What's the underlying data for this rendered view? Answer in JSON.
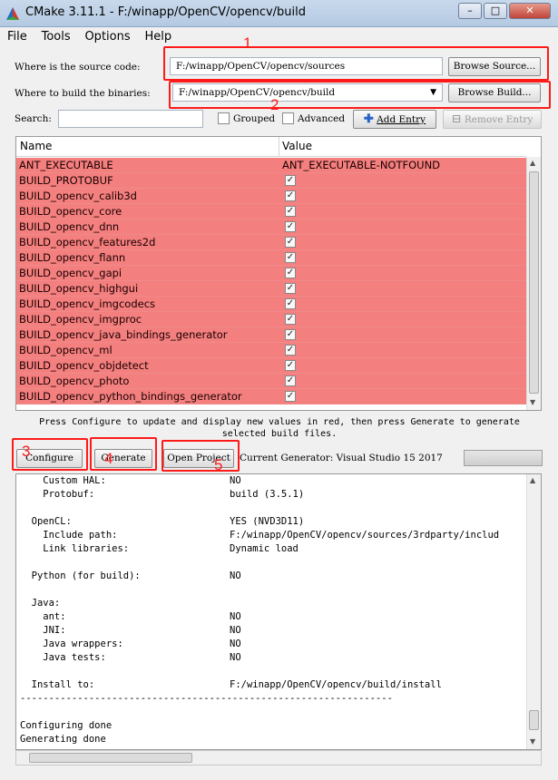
{
  "window": {
    "title": "CMake 3.11.1 - F:/winapp/OpenCV/opencv/build",
    "minimize": "–",
    "maximize": "□",
    "close": "✕"
  },
  "menu": [
    "File",
    "Tools",
    "Options",
    "Help"
  ],
  "source": {
    "label": "Where is the source code:",
    "value": "F:/winapp/OpenCV/opencv/sources",
    "browse": "Browse Source..."
  },
  "build": {
    "label": "Where to build the binaries:",
    "value": "F:/winapp/OpenCV/opencv/build",
    "browse": "Browse Build..."
  },
  "search": {
    "label": "Search:",
    "value": ""
  },
  "grouped": {
    "label": "Grouped",
    "checked": false
  },
  "advanced": {
    "label": "Advanced",
    "checked": false
  },
  "add_entry": "Add Entry",
  "remove_entry": "Remove Entry",
  "table": {
    "headers": [
      "Name",
      "Value"
    ],
    "rows": [
      {
        "name": "ANT_EXECUTABLE",
        "value": "ANT_EXECUTABLE-NOTFOUND",
        "type": "text"
      },
      {
        "name": "BUILD_PROTOBUF",
        "value": "true",
        "type": "bool"
      },
      {
        "name": "BUILD_opencv_calib3d",
        "value": "true",
        "type": "bool"
      },
      {
        "name": "BUILD_opencv_core",
        "value": "true",
        "type": "bool"
      },
      {
        "name": "BUILD_opencv_dnn",
        "value": "true",
        "type": "bool"
      },
      {
        "name": "BUILD_opencv_features2d",
        "value": "true",
        "type": "bool"
      },
      {
        "name": "BUILD_opencv_flann",
        "value": "true",
        "type": "bool"
      },
      {
        "name": "BUILD_opencv_gapi",
        "value": "true",
        "type": "bool"
      },
      {
        "name": "BUILD_opencv_highgui",
        "value": "true",
        "type": "bool"
      },
      {
        "name": "BUILD_opencv_imgcodecs",
        "value": "true",
        "type": "bool"
      },
      {
        "name": "BUILD_opencv_imgproc",
        "value": "true",
        "type": "bool"
      },
      {
        "name": "BUILD_opencv_java_bindings_generator",
        "value": "true",
        "type": "bool"
      },
      {
        "name": "BUILD_opencv_ml",
        "value": "true",
        "type": "bool"
      },
      {
        "name": "BUILD_opencv_objdetect",
        "value": "true",
        "type": "bool"
      },
      {
        "name": "BUILD_opencv_photo",
        "value": "true",
        "type": "bool"
      },
      {
        "name": "BUILD_opencv_python_bindings_generator",
        "value": "true",
        "type": "bool"
      }
    ],
    "row_color": "#f47f7f"
  },
  "info_text": "Press Configure to update and display new values in red, then press Generate to generate selected build files.",
  "buttons": {
    "configure": "Configure",
    "generate": "Generate",
    "open_project": "Open Project"
  },
  "generator": "Current Generator: Visual Studio 15 2017",
  "output_lines": [
    {
      "k": "    Custom HAL:",
      "v": "NO"
    },
    {
      "k": "    Protobuf:",
      "v": "build (3.5.1)"
    },
    {
      "k": "",
      "v": ""
    },
    {
      "k": "  OpenCL:",
      "v": "YES (NVD3D11)"
    },
    {
      "k": "    Include path:",
      "v": "F:/winapp/OpenCV/opencv/sources/3rdparty/includ"
    },
    {
      "k": "    Link libraries:",
      "v": "Dynamic load"
    },
    {
      "k": "",
      "v": ""
    },
    {
      "k": "  Python (for build):",
      "v": "NO"
    },
    {
      "k": "",
      "v": ""
    },
    {
      "k": "  Java:",
      "v": ""
    },
    {
      "k": "    ant:",
      "v": "NO"
    },
    {
      "k": "    JNI:",
      "v": "NO"
    },
    {
      "k": "    Java wrappers:",
      "v": "NO"
    },
    {
      "k": "    Java tests:",
      "v": "NO"
    },
    {
      "k": "",
      "v": ""
    },
    {
      "k": "  Install to:",
      "v": "F:/winapp/OpenCV/opencv/build/install"
    },
    {
      "k": "-----------------------------------------------------------------",
      "v": ""
    },
    {
      "k": "",
      "v": ""
    },
    {
      "k": "Configuring done",
      "v": ""
    },
    {
      "k": "Generating done",
      "v": ""
    }
  ],
  "annotations": [
    "1",
    "2",
    "3",
    "4",
    "5"
  ],
  "annotation_color": "#ff1a1a"
}
